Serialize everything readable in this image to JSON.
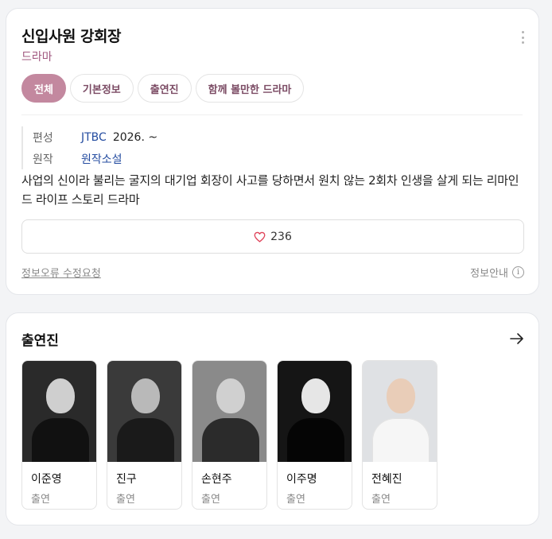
{
  "info": {
    "title": "신입사원 강회장",
    "genre": "드라마",
    "tabs": [
      {
        "label": "전체",
        "active": true
      },
      {
        "label": "기본정보",
        "active": false
      },
      {
        "label": "출연진",
        "active": false
      },
      {
        "label": "함께 볼만한 드라마",
        "active": false
      }
    ],
    "meta": {
      "broadcast_label": "편성",
      "broadcast_channel": "JTBC",
      "broadcast_date": "2026. ~",
      "original_label": "원작",
      "original_value": "원작소설"
    },
    "synopsis": "사업의 신이라 불리는 굴지의 대기업 회장이 사고를 당하면서 원치 않는 2회차 인생을 살게 되는 리마인드 라이프 스토리 드라마",
    "likes": "236",
    "report_link": "정보오류 수정요청",
    "notice": "정보안내",
    "info_icon_glyph": "i"
  },
  "cast": {
    "title": "출연진",
    "members": [
      {
        "name": "이준영",
        "role": "출연"
      },
      {
        "name": "진구",
        "role": "출연"
      },
      {
        "name": "손현주",
        "role": "출연"
      },
      {
        "name": "이주명",
        "role": "출연"
      },
      {
        "name": "전혜진",
        "role": "출연"
      }
    ]
  },
  "colors": {
    "accent": "#c3889f",
    "genre_text": "#a0577f",
    "link": "#244ca0",
    "heart": "#e0455b"
  },
  "icons": {
    "more": "more-vertical-icon",
    "like": "heart-icon",
    "info": "info-icon",
    "cast_more": "arrow-right-icon"
  }
}
